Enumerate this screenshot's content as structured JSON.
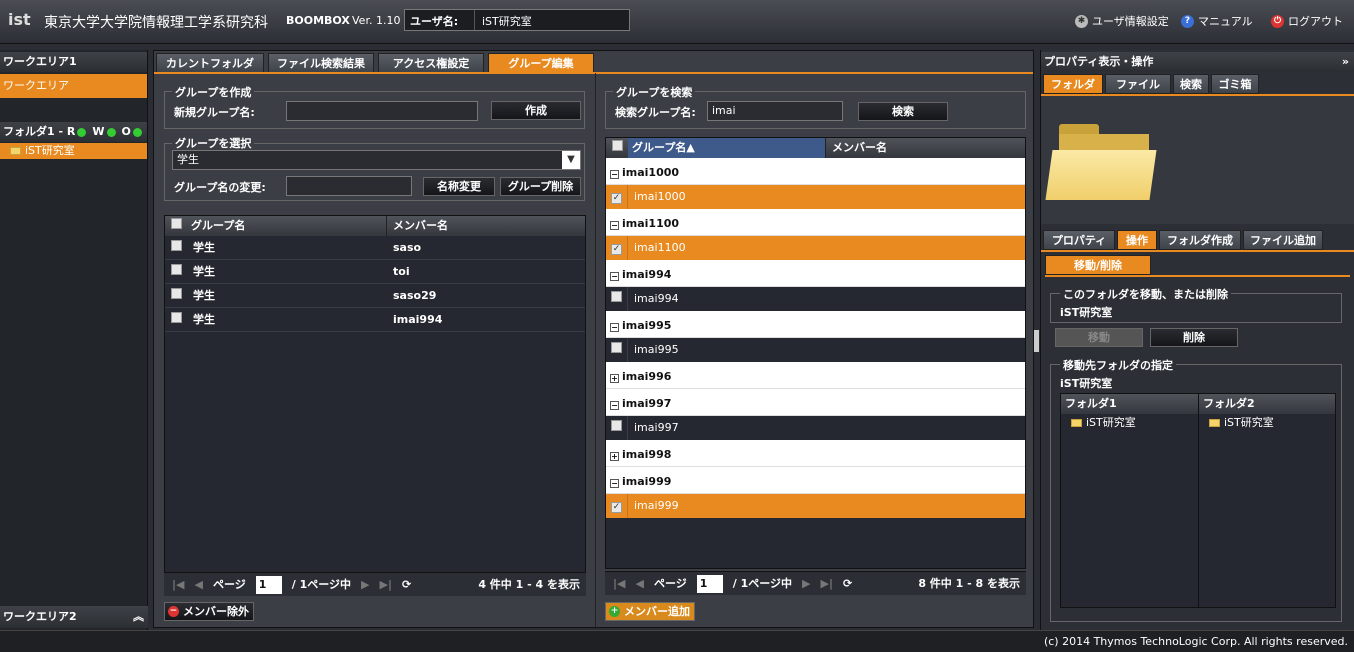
{
  "header": {
    "logo": "ist",
    "org": "東京大学大学院情報理工学系研究科",
    "product": "BOOMBOX",
    "version": "Ver. 1.10",
    "user_label": "ユーザ名:",
    "user_value": "iST研究室",
    "links": {
      "user_settings": "ユーザ情報設定",
      "manual": "マニュアル",
      "logout": "ログアウト"
    }
  },
  "left": {
    "workarea1": "ワークエリア1",
    "workarea": "ワークエリア",
    "folder1_label": "フォルダ1 - R",
    "folder1_w": "W",
    "folder1_o": "O",
    "folder_item": "iST研究室",
    "workarea2": "ワークエリア2"
  },
  "tabs": [
    "カレントフォルダ",
    "ファイル検索結果",
    "アクセス権設定",
    "グループ編集"
  ],
  "create": {
    "legend": "グループを作成",
    "label": "新規グループ名:",
    "value": "",
    "button": "作成"
  },
  "select": {
    "legend": "グループを選択",
    "value": "学生",
    "rename_label": "グループ名の変更:",
    "rename_value": "",
    "rename_button": "名称変更",
    "delete_button": "グループ削除"
  },
  "members_grid": {
    "col_group": "グループ名",
    "col_member": "メンバー名",
    "rows": [
      {
        "group": "学生",
        "member": "saso"
      },
      {
        "group": "学生",
        "member": "toi"
      },
      {
        "group": "学生",
        "member": "saso29"
      },
      {
        "group": "学生",
        "member": "imai994"
      }
    ],
    "pager": {
      "page_label": "ページ",
      "page": "1",
      "of": "/ 1ページ中",
      "summary": "4 件中 1 - 4 を表示"
    },
    "remove_button": "メンバー除外"
  },
  "search": {
    "legend": "グループを検索",
    "label": "検索グループ名:",
    "value": "imai",
    "button": "検索"
  },
  "search_grid": {
    "col_group": "グループ名▲",
    "col_member": "メンバー名",
    "groups": [
      {
        "name": "imai1000",
        "expanded": true,
        "items": [
          {
            "name": "imai1000",
            "checked": true
          }
        ]
      },
      {
        "name": "imai1100",
        "expanded": true,
        "items": [
          {
            "name": "imai1100",
            "checked": true
          }
        ]
      },
      {
        "name": "imai994",
        "expanded": true,
        "items": [
          {
            "name": "imai994",
            "checked": false
          }
        ]
      },
      {
        "name": "imai995",
        "expanded": true,
        "items": [
          {
            "name": "imai995",
            "checked": false
          }
        ]
      },
      {
        "name": "imai996",
        "expanded": false,
        "items": []
      },
      {
        "name": "imai997",
        "expanded": true,
        "items": [
          {
            "name": "imai997",
            "checked": false
          }
        ]
      },
      {
        "name": "imai998",
        "expanded": false,
        "items": []
      },
      {
        "name": "imai999",
        "expanded": true,
        "items": [
          {
            "name": "imai999",
            "checked": true
          }
        ]
      }
    ],
    "pager": {
      "page_label": "ページ",
      "page": "1",
      "of": "/ 1ページ中",
      "summary": "8 件中 1 - 8 を表示"
    },
    "add_button": "メンバー追加"
  },
  "right": {
    "title": "プロパティ表示・操作",
    "tabs1": [
      "フォルダ",
      "ファイル",
      "検索",
      "ゴミ箱"
    ],
    "tabs2": [
      "プロパティ",
      "操作",
      "フォルダ作成",
      "ファイル追加"
    ],
    "subtab": "移動/削除",
    "move_legend": "このフォルダを移動、または削除",
    "folder_name": "iST研究室",
    "move_button": "移動",
    "delete_button": "削除",
    "dest_legend": "移動先フォルダの指定",
    "dest_folder": "iST研究室",
    "col1": "フォルダ1",
    "col2": "フォルダ2",
    "col1_item": "iST研究室",
    "col2_item": "iST研究室"
  },
  "footer": "(c) 2014 Thymos TechnoLogic Corp. All rights reserved.",
  "colors": {
    "accent": "#e88a1f",
    "bg": "#3b3e45"
  }
}
